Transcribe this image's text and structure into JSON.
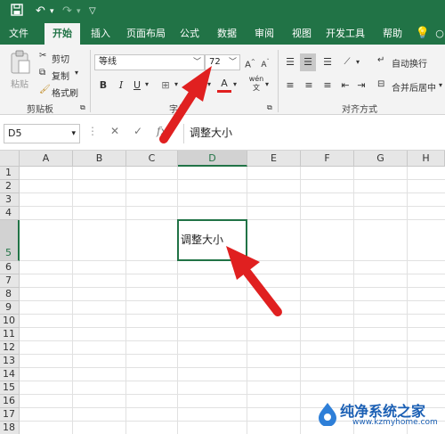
{
  "quick_access": {
    "more": "▽"
  },
  "tabs": [
    "文件",
    "开始",
    "插入",
    "页面布局",
    "公式",
    "数据",
    "审阅",
    "视图",
    "开发工具",
    "帮助"
  ],
  "active_tab": "开始",
  "clipboard": {
    "paste_label": "粘贴",
    "cut_label": "剪切",
    "copy_label": "复制",
    "format_painter_label": "格式刷",
    "group_label": "剪贴板"
  },
  "font": {
    "font_name": "等线",
    "font_size": "72",
    "bold": "B",
    "italic": "I",
    "underline": "U",
    "group_label": "字体"
  },
  "alignment": {
    "wrap_text_label": "自动换行",
    "merge_center_label": "合并后居中",
    "group_label": "对齐方式"
  },
  "formula_bar": {
    "name_box": "D5",
    "content": "调整大小"
  },
  "sheet": {
    "columns": [
      "A",
      "B",
      "C",
      "D",
      "E",
      "F",
      "G",
      "H"
    ],
    "rows": [
      "1",
      "2",
      "3",
      "4",
      "5",
      "6",
      "7",
      "8",
      "9",
      "10",
      "11",
      "12",
      "13",
      "14",
      "15",
      "16",
      "17",
      "18"
    ],
    "selected_cell": "D5",
    "selected_cell_value": "调整大小"
  },
  "watermark": {
    "site_name": "纯净系统之家",
    "url": "www.kzmyhome.com"
  },
  "colors": {
    "excel_green": "#217346",
    "arrow_red": "#e02020"
  }
}
